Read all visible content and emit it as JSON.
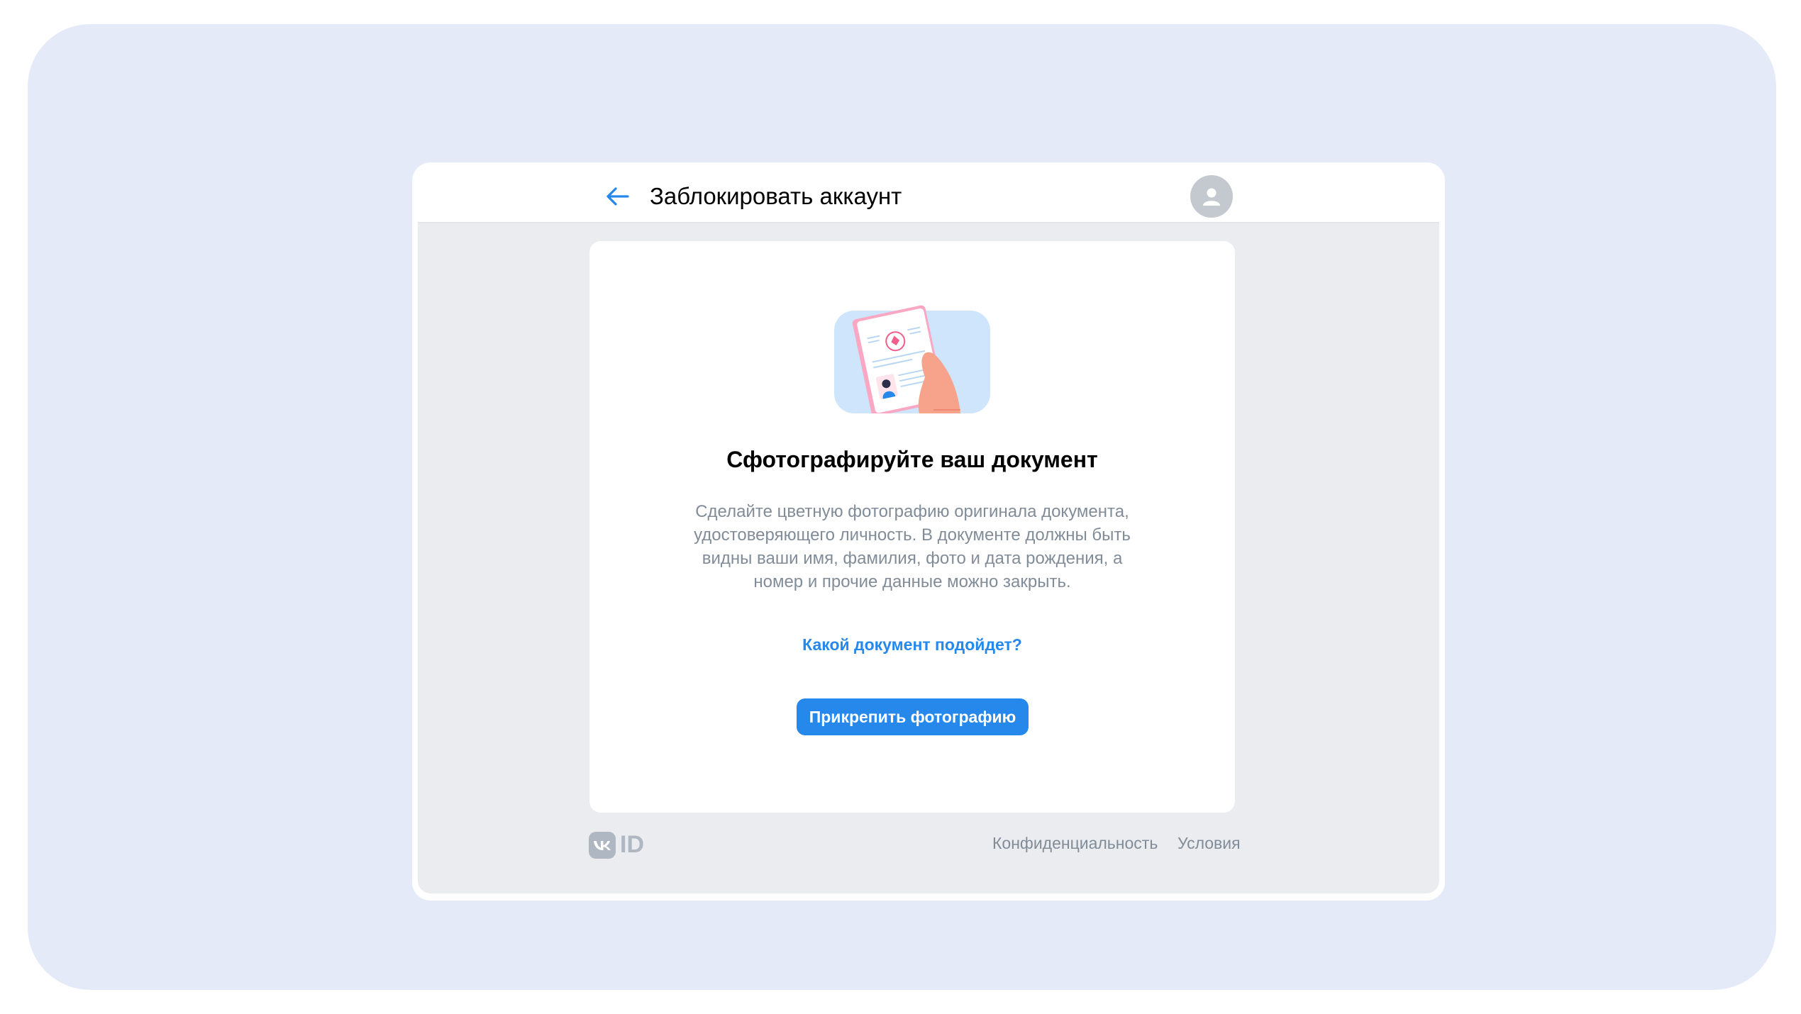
{
  "header": {
    "title": "Заблокировать аккаунт"
  },
  "card": {
    "title": "Сфотографируйте ваш документ",
    "description": "Сделайте цветную фотографию оригинала документа, удостоверяющего личность. В документе должны быть видны ваши имя, фамилия, фото и дата рождения, а номер и прочие данные можно закрыть.",
    "help_link": "Какой документ подойдет?",
    "attach_button": "Прикрепить фотографию"
  },
  "footer": {
    "logo_text": "ID",
    "privacy": "Конфиденциальность",
    "terms": "Условия"
  },
  "colors": {
    "accent": "#2688eb",
    "page_bg": "#e4eaf7",
    "window_bg": "#ebecf0",
    "secondary_text": "#818c99"
  },
  "icons": {
    "back": "arrow-left-icon",
    "avatar": "user-avatar-icon",
    "illustration": "passport-in-hand-illustration",
    "logo": "vk-logo-icon"
  }
}
